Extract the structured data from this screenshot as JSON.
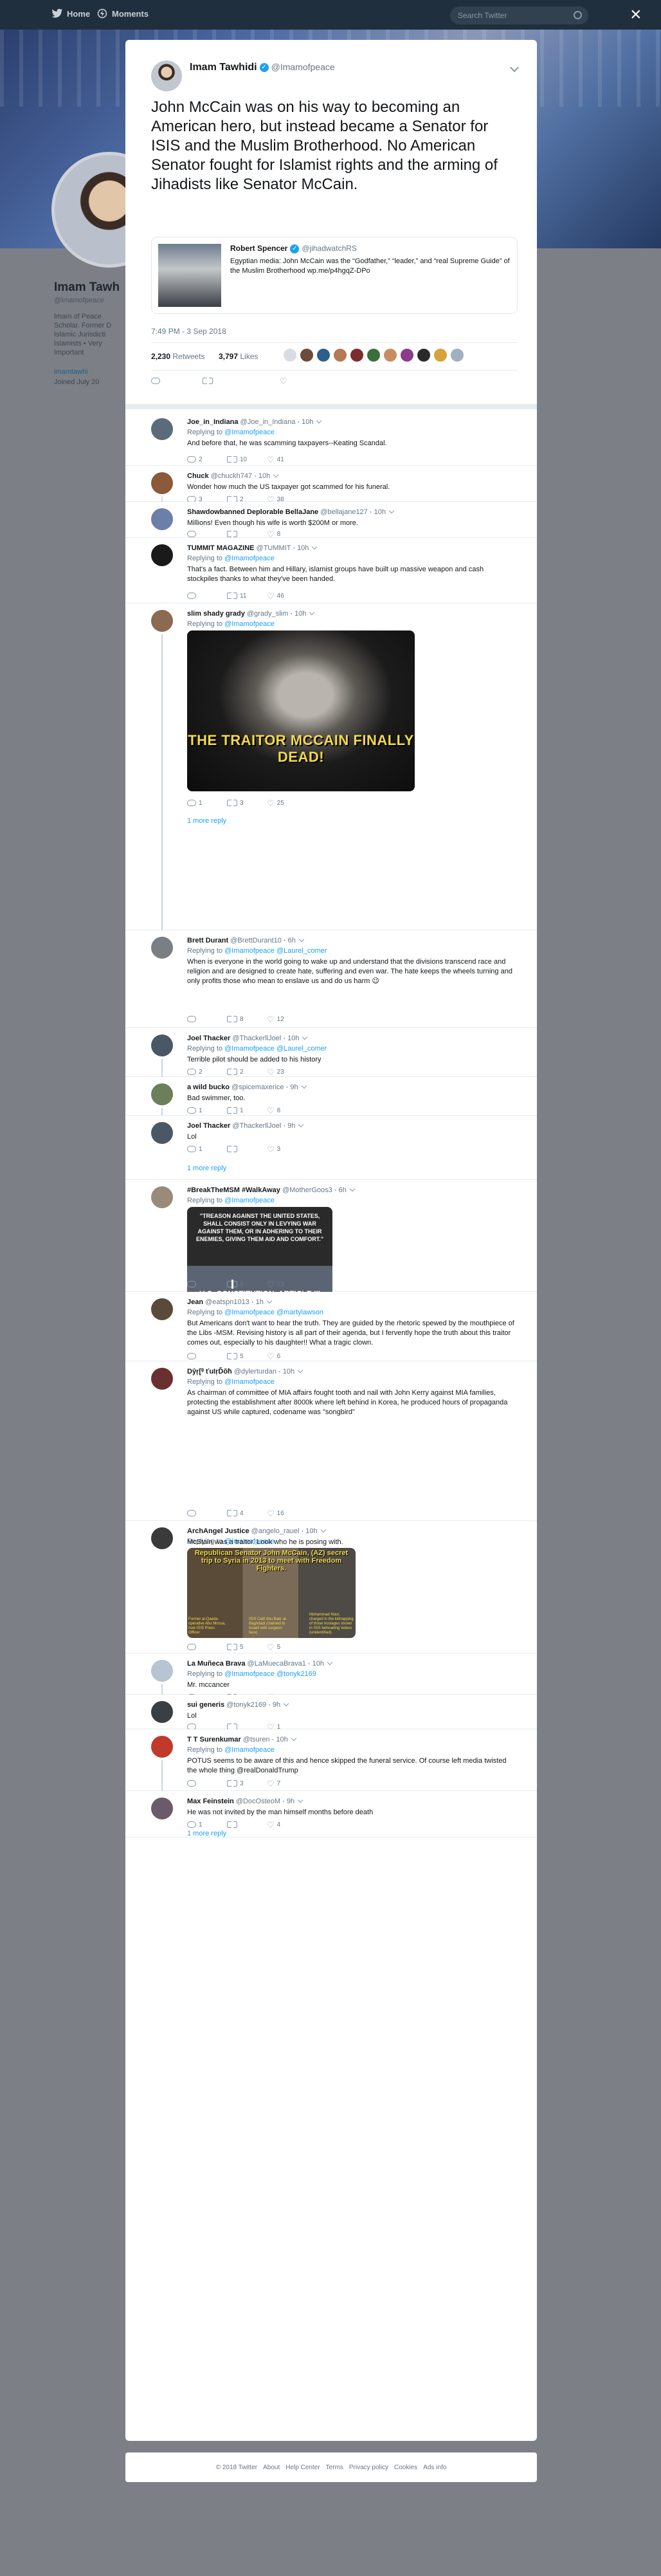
{
  "nav": {
    "home": "Home",
    "moments": "Moments",
    "search_placeholder": "Search Twitter",
    "close": "×"
  },
  "profile": {
    "name": "Imam Tawh",
    "handle": "@Imamofpeace",
    "bio": [
      "Imam of Peace",
      "Scholar. Former D",
      "Islamic Jurisdicti",
      "Islamists • Very",
      "Important"
    ],
    "link": "imamtawhi",
    "joined": "Joined July 20"
  },
  "tweet": {
    "name": "Imam Tawhidi",
    "handle": "@Imamofpeace",
    "text": "John McCain was on his way to becoming an American hero, but instead became a Senator for ISIS and the Muslim Brotherhood. No American Senator fought for Islamist rights and the arming of Jihadists like Senator McCain.",
    "quote": {
      "name": "Robert Spencer",
      "handle": "@jihadwatchRS",
      "text": "Egyptian media: John McCain was the “Godfather,” “leader,” and “real Supreme Guide” of the Muslim Brotherhood wp.me/p4hgqZ-DPo"
    },
    "time": "7:49 PM - 3 Sep 2018",
    "retweets": "2,230",
    "retweets_label": "Retweets",
    "likes": "3,797",
    "likes_label": "Likes",
    "liker_colors": [
      "#d9dde2",
      "#6b4b3a",
      "#2e5f8a",
      "#b47a55",
      "#7b2d2d",
      "#3a6f3a",
      "#c98c62",
      "#8b3c8b",
      "#2a2a2a",
      "#d6a23c",
      "#9fb0c2"
    ]
  },
  "replies": [
    {
      "name": "Joe_in_Indiana",
      "handle": "@Joe_in_Indiana",
      "time": "10h",
      "to": "@Imamofpeace",
      "text": "And before that, he was scamming taxpayers--Keating Scandal.",
      "reply": "2",
      "rt": "10",
      "like": "41",
      "av": "#5b6b7a"
    },
    {
      "name": "Chuck",
      "handle": "@chuckh747",
      "time": "10h",
      "to": "",
      "text": "Wonder how much the US taxpayer got scammed for his funeral.",
      "reply": "3",
      "rt": "2",
      "like": "38",
      "av": "#8a5a3a"
    },
    {
      "name": "Shawdowbanned Deplorable BellaJane",
      "handle": "@bellajane127",
      "time": "10h",
      "to": "",
      "text": "Millions! Even though his wife is worth $200M or more.",
      "reply": "",
      "rt": "",
      "like": "8",
      "av": "#6c7fa8"
    },
    {
      "name": "TUMMIT MAGAZINE",
      "handle": "@TUMMIT",
      "time": "10h",
      "to": "@Imamofpeace",
      "text": "That's a fact. Between him and Hillary, islamist groups have built up massive weapon and cash stockpiles thanks to what they've been handed.",
      "reply": "",
      "rt": "11",
      "like": "46",
      "av": "#1a1a1a"
    },
    {
      "name": "slim shady grady",
      "handle": "@grady_slim",
      "time": "10h",
      "to": "@Imamofpeace",
      "text": "",
      "media_text": "THE TRAITOR MCCAIN FINALLY DEAD!",
      "reply": "1",
      "rt": "3",
      "like": "25",
      "more": "1 more reply",
      "av": "#8a6a50"
    },
    {
      "name": "Brett Durant",
      "handle": "@BrettDurant10",
      "time": "6h",
      "to": "@Imamofpeace @Laurel_comer",
      "text": "When is everyone in the world going to wake up and understand that the divisions transcend race and religion and are designed to create hate, suffering and even war. The hate keeps the wheels turning and only profits those who mean to enslave us and do us harm 😉",
      "reply": "",
      "rt": "8",
      "like": "12",
      "av": "#7a7f86"
    },
    {
      "name": "Joel Thacker",
      "handle": "@ThackerllJoel",
      "time": "10h",
      "to": "@Imamofpeace @Laurel_comer",
      "text": "Terrible pilot should be added to his history",
      "reply": "2",
      "rt": "2",
      "like": "23",
      "av": "#4a5866"
    },
    {
      "name": "a wild bucko",
      "handle": "@spicemaxerice",
      "time": "9h",
      "to": "",
      "text": "Bad swimmer, too.",
      "reply": "1",
      "rt": "1",
      "like": "8",
      "av": "#6a7f5a"
    },
    {
      "name": "Joel Thacker",
      "handle": "@ThackerllJoel",
      "time": "9h",
      "to": "",
      "text": "Lol",
      "reply": "1",
      "rt": "",
      "like": "3",
      "more": "1 more reply",
      "av": "#4a5866"
    },
    {
      "name": "#BreakTheMSM #WalkAway",
      "handle": "@MotherGoos3",
      "time": "6h",
      "to": "@Imamofpeace",
      "text": "",
      "media_text": "\"TREASON AGAINST THE UNITED STATES, SHALL CONSIST ONLY IN LEVYING WAR AGAINST THEM, OR IN ADHERING TO THEIR ENEMIES, GIVING THEM AID AND COMFORT.\"",
      "media_text2": "U.S. CONSTITUTION, ARTICLE III SECTION 3",
      "reply": "",
      "rt": "4",
      "like": "13",
      "av": "#9a8a7a"
    },
    {
      "name": "Jean",
      "handle": "@eatspn1013",
      "time": "1h",
      "to": "@Imamofpeace @martylawson",
      "text": "But Americans don't want to hear the truth. They are guided by the rhetoric spewed by the mouthpiece of the Libs -MSM. Revising history is all part of their agenda, but I fervently hope the truth about this traitor comes out, especially to his daughter!! What a tragic clown.",
      "reply": "",
      "rt": "5",
      "like": "6",
      "av": "#5a4a3a"
    },
    {
      "name": "Dŷŗ[ᶿ ťuIŗĎŏħ",
      "handle": "@dylerturdan",
      "time": "10h",
      "to": "@Imamofpeace",
      "text": "As chairman of committee of MIA affairs fought tooth and nail with John Kerry against MIA families, protecting the establishment after 8000k where left behind in Korea, he produced hours of propaganda against US while captured, codename was \"songbird\"",
      "reply": "",
      "rt": "4",
      "like": "16",
      "av": "#6a2f2f"
    },
    {
      "name": "ArchAngel Justice",
      "handle": "@angelo_rauel",
      "time": "10h",
      "to": "@Imamofpeace",
      "text": "McStain was a traitor. Look who he is posing with.",
      "media_text": "Republican Senator John McCain, (AZ) secret trip to Syria in 2013 to meet with Freedom Fighters.",
      "media_cap1": "Former al-Qaeda operative Abu Mossa, now ISIS Press Officer",
      "media_cap2": "ISIS Calif Abu Bakr al-Baghdadi (claimed to Israeli with surgeon face)",
      "media_cap3": "Mohammad Nour, charged in the kidnapping of those hostages shown in ISIS beheading videos (unidentified)",
      "reply": "",
      "rt": "5",
      "like": "5",
      "av": "#3a3a3a"
    },
    {
      "name": "La Muñeca Brava",
      "handle": "@LaMuecaBrava1",
      "time": "10h",
      "to": "@Imamofpeace @tonyk2169",
      "text": "Mr. mccancer",
      "reply": "2",
      "rt": "2",
      "like": "6",
      "av": "#b7c4d1"
    },
    {
      "name": "sui generis",
      "handle": "@tonyk2169",
      "time": "9h",
      "to": "",
      "text": "Lol",
      "reply": "",
      "rt": "",
      "like": "1",
      "av": "#3a3f44"
    },
    {
      "name": "T T Surenkumar",
      "handle": "@tsuren",
      "time": "10h",
      "to": "@Imamofpeace",
      "text": "POTUS seems to be aware of this and hence skipped the funeral service. Of course left media twisted the whole thing @realDonaldTrump",
      "reply": "",
      "rt": "3",
      "like": "7",
      "av": "#c0392b"
    },
    {
      "name": "Max Feinstein",
      "handle": "@DocOsteoM",
      "time": "9h",
      "to": "",
      "text": "He was not invited by the man himself months before death",
      "reply": "1",
      "rt": "",
      "like": "4",
      "more": "1 more reply",
      "av": "#6b5a6a"
    }
  ],
  "footer": [
    "© 2018 Twitter",
    "About",
    "Help Center",
    "Terms",
    "Privacy policy",
    "Cookies",
    "Ads info"
  ]
}
